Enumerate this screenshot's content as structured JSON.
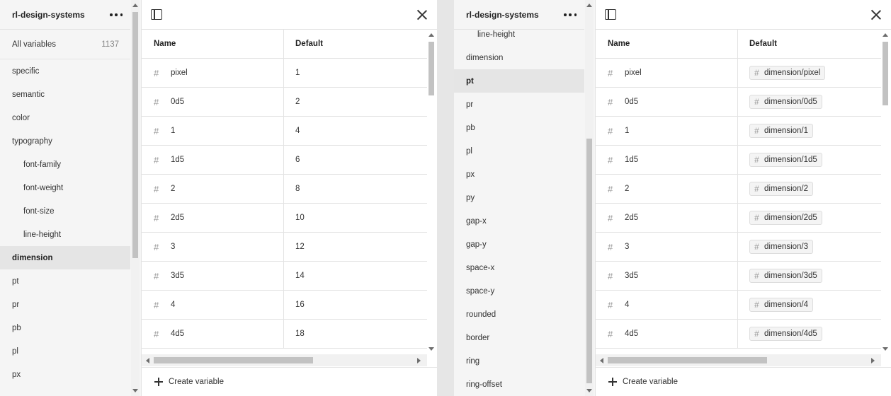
{
  "left": {
    "sidebar": {
      "title": "rl-design-systems",
      "all_label": "All variables",
      "all_count": "1137",
      "items": [
        {
          "label": "specific",
          "indent": false,
          "active": false
        },
        {
          "label": "semantic",
          "indent": false,
          "active": false
        },
        {
          "label": "color",
          "indent": false,
          "active": false
        },
        {
          "label": "typography",
          "indent": false,
          "active": false
        },
        {
          "label": "font-family",
          "indent": true,
          "active": false
        },
        {
          "label": "font-weight",
          "indent": true,
          "active": false
        },
        {
          "label": "font-size",
          "indent": true,
          "active": false
        },
        {
          "label": "line-height",
          "indent": true,
          "active": false
        },
        {
          "label": "dimension",
          "indent": false,
          "active": true
        },
        {
          "label": "pt",
          "indent": false,
          "active": false
        },
        {
          "label": "pr",
          "indent": false,
          "active": false
        },
        {
          "label": "pb",
          "indent": false,
          "active": false
        },
        {
          "label": "pl",
          "indent": false,
          "active": false
        },
        {
          "label": "px",
          "indent": false,
          "active": false
        }
      ]
    },
    "table": {
      "col_name": "Name",
      "col_default": "Default",
      "rows": [
        {
          "name": "pixel",
          "value": "1"
        },
        {
          "name": "0d5",
          "value": "2"
        },
        {
          "name": "1",
          "value": "4"
        },
        {
          "name": "1d5",
          "value": "6"
        },
        {
          "name": "2",
          "value": "8"
        },
        {
          "name": "2d5",
          "value": "10"
        },
        {
          "name": "3",
          "value": "12"
        },
        {
          "name": "3d5",
          "value": "14"
        },
        {
          "name": "4",
          "value": "16"
        },
        {
          "name": "4d5",
          "value": "18"
        }
      ]
    },
    "footer": {
      "create_label": "Create variable"
    }
  },
  "right": {
    "sidebar": {
      "title": "rl-design-systems",
      "items": [
        {
          "label": "line-height",
          "indent": true,
          "active": false
        },
        {
          "label": "dimension",
          "indent": false,
          "active": false
        },
        {
          "label": "pt",
          "indent": false,
          "active": true
        },
        {
          "label": "pr",
          "indent": false,
          "active": false
        },
        {
          "label": "pb",
          "indent": false,
          "active": false
        },
        {
          "label": "pl",
          "indent": false,
          "active": false
        },
        {
          "label": "px",
          "indent": false,
          "active": false
        },
        {
          "label": "py",
          "indent": false,
          "active": false
        },
        {
          "label": "gap-x",
          "indent": false,
          "active": false
        },
        {
          "label": "gap-y",
          "indent": false,
          "active": false
        },
        {
          "label": "space-x",
          "indent": false,
          "active": false
        },
        {
          "label": "space-y",
          "indent": false,
          "active": false
        },
        {
          "label": "rounded",
          "indent": false,
          "active": false
        },
        {
          "label": "border",
          "indent": false,
          "active": false
        },
        {
          "label": "ring",
          "indent": false,
          "active": false
        },
        {
          "label": "ring-offset",
          "indent": false,
          "active": false
        }
      ]
    },
    "table": {
      "col_name": "Name",
      "col_default": "Default",
      "rows": [
        {
          "name": "pixel",
          "value": "dimension/pixel"
        },
        {
          "name": "0d5",
          "value": "dimension/0d5"
        },
        {
          "name": "1",
          "value": "dimension/1"
        },
        {
          "name": "1d5",
          "value": "dimension/1d5"
        },
        {
          "name": "2",
          "value": "dimension/2"
        },
        {
          "name": "2d5",
          "value": "dimension/2d5"
        },
        {
          "name": "3",
          "value": "dimension/3"
        },
        {
          "name": "3d5",
          "value": "dimension/3d5"
        },
        {
          "name": "4",
          "value": "dimension/4"
        },
        {
          "name": "4d5",
          "value": "dimension/4d5"
        }
      ]
    },
    "footer": {
      "create_label": "Create variable"
    }
  },
  "icons": {
    "number_type": "hash-icon",
    "more": "more-icon",
    "sidebar_toggle": "sidebar-toggle-icon",
    "close": "close-icon",
    "add": "plus-icon"
  }
}
